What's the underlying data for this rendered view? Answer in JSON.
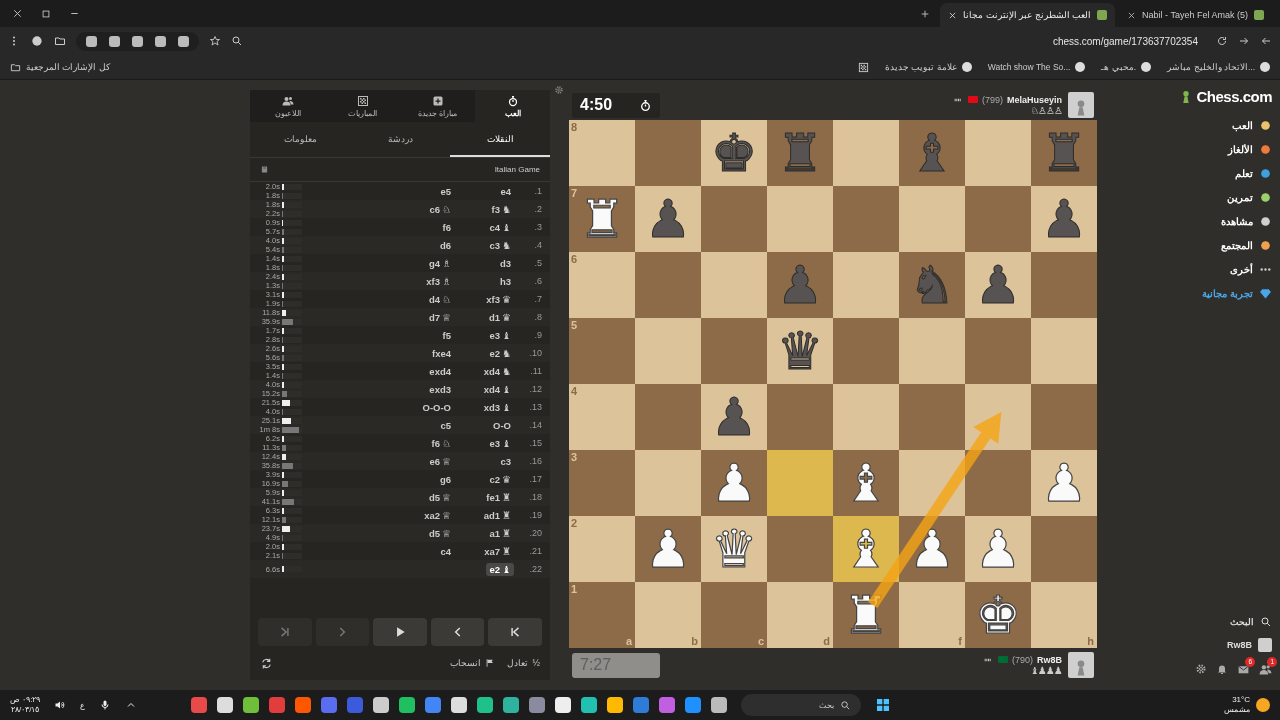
{
  "browser": {
    "tabs": [
      {
        "title": "العب الشطرنج عبر الإنترنت مجانا",
        "selected": true
      },
      {
        "title": "(5) Nabil - Tayeh Fel Amak",
        "selected": false
      }
    ],
    "address": "chess.com/game/173637702354",
    "bookmarks": [
      {
        "label": "الاتحاد والخليج مباشر..."
      },
      {
        "label": "محبي هـ."
      },
      {
        "label": "Watch show The So..."
      },
      {
        "label": "علامة تبويب جديدة"
      }
    ],
    "all_bookmarks": "كل الإشارات المرجعية"
  },
  "panel": {
    "top_tabs": [
      {
        "label": "العب",
        "selected": true
      },
      {
        "label": "مباراة جديدة",
        "selected": false
      },
      {
        "label": "المباريات",
        "selected": false
      },
      {
        "label": "اللاعبون",
        "selected": false
      }
    ],
    "sub_tabs": [
      {
        "label": "النقلات",
        "selected": true
      },
      {
        "label": "دردشة",
        "selected": false
      },
      {
        "label": "معلومات",
        "selected": false
      }
    ],
    "opening": "Italian Game",
    "moves": [
      {
        "number": "1.",
        "white": {
          "san": "e4",
          "selected": false
        },
        "black": {
          "san": "e5",
          "selected": false
        },
        "times": [
          {
            "text": "2.0s",
            "level": 0.08
          },
          {
            "text": "1.8s",
            "level": 0.06
          }
        ]
      },
      {
        "number": "2.",
        "white": {
          "san": "f3",
          "figure": "♞",
          "selected": false
        },
        "black": {
          "san": "c6",
          "figure": "♘",
          "selected": false
        },
        "times": [
          {
            "text": "1.8s",
            "level": 0.08
          },
          {
            "text": "2.2s",
            "level": 0.06
          }
        ]
      },
      {
        "number": "3.",
        "white": {
          "san": "c4",
          "figure": "♝",
          "selected": false
        },
        "black": {
          "san": "f6",
          "selected": false
        },
        "times": [
          {
            "text": "0.9s",
            "level": 0.06
          },
          {
            "text": "5.7s",
            "level": 0.08
          }
        ]
      },
      {
        "number": "4.",
        "white": {
          "san": "c3",
          "figure": "♞",
          "selected": false
        },
        "black": {
          "san": "d6",
          "selected": false
        },
        "times": [
          {
            "text": "4.0s",
            "level": 0.1
          },
          {
            "text": "5.4s",
            "level": 0.08
          }
        ]
      },
      {
        "number": "5.",
        "white": {
          "san": "d3",
          "selected": false
        },
        "black": {
          "san": "g4",
          "figure": "♗",
          "selected": false
        },
        "times": [
          {
            "text": "1.4s",
            "level": 0.08
          },
          {
            "text": "1.8s",
            "level": 0.06
          }
        ]
      },
      {
        "number": "6.",
        "white": {
          "san": "h3",
          "selected": false
        },
        "black": {
          "san": "xf3",
          "figure": "♗",
          "selected": false
        },
        "times": [
          {
            "text": "2.4s",
            "level": 0.08
          },
          {
            "text": "1.3s",
            "level": 0.06
          }
        ]
      },
      {
        "number": "7.",
        "white": {
          "san": "xf3",
          "figure": "♛",
          "selected": false
        },
        "black": {
          "san": "d4",
          "figure": "♘",
          "selected": false
        },
        "times": [
          {
            "text": "3.1s",
            "level": 0.08
          },
          {
            "text": "1.9s",
            "level": 0.06
          }
        ]
      },
      {
        "number": "8.",
        "white": {
          "san": "d1",
          "figure": "♛",
          "selected": false
        },
        "black": {
          "san": "d7",
          "figure": "♕",
          "selected": false
        },
        "times": [
          {
            "text": "11.8s",
            "level": 0.2
          },
          {
            "text": "35.9s",
            "level": 0.55
          }
        ]
      },
      {
        "number": "9.",
        "white": {
          "san": "e3",
          "figure": "♝",
          "selected": false
        },
        "black": {
          "san": "f5",
          "selected": false
        },
        "times": [
          {
            "text": "1.7s",
            "level": 0.08
          },
          {
            "text": "2.8s",
            "level": 0.06
          }
        ]
      },
      {
        "number": "10.",
        "white": {
          "san": "e2",
          "figure": "♞",
          "selected": false
        },
        "black": {
          "san": "fxe4",
          "selected": false
        },
        "times": [
          {
            "text": "2.6s",
            "level": 0.08
          },
          {
            "text": "5.6s",
            "level": 0.08
          }
        ]
      },
      {
        "number": "11.",
        "white": {
          "san": "xd4",
          "figure": "♞",
          "selected": false
        },
        "black": {
          "san": "exd4",
          "selected": false
        },
        "times": [
          {
            "text": "3.5s",
            "level": 0.1
          },
          {
            "text": "1.4s",
            "level": 0.06
          }
        ]
      },
      {
        "number": "12.",
        "white": {
          "san": "xd4",
          "figure": "♝",
          "selected": false
        },
        "black": {
          "san": "exd3",
          "selected": false
        },
        "times": [
          {
            "text": "4.0s",
            "level": 0.1
          },
          {
            "text": "15.2s",
            "level": 0.25
          }
        ]
      },
      {
        "number": "13.",
        "white": {
          "san": "xd3",
          "figure": "♝",
          "selected": false
        },
        "black": {
          "san": "O-O-O",
          "selected": false
        },
        "times": [
          {
            "text": "21.5s",
            "level": 0.4
          },
          {
            "text": "4.0s",
            "level": 0.06
          }
        ]
      },
      {
        "number": "14.",
        "white": {
          "san": "O-O",
          "selected": false
        },
        "black": {
          "san": "c5",
          "selected": false
        },
        "times": [
          {
            "text": "25.1s",
            "level": 0.45
          },
          {
            "text": "1m 8s",
            "level": 0.85
          }
        ]
      },
      {
        "number": "15.",
        "white": {
          "san": "e3",
          "figure": "♝",
          "selected": false
        },
        "black": {
          "san": "f6",
          "figure": "♘",
          "selected": false
        },
        "times": [
          {
            "text": "6.2s",
            "level": 0.1
          },
          {
            "text": "11.3s",
            "level": 0.2
          }
        ]
      },
      {
        "number": "16.",
        "white": {
          "san": "c3",
          "selected": false
        },
        "black": {
          "san": "e6",
          "figure": "♕",
          "selected": false
        },
        "times": [
          {
            "text": "12.4s",
            "level": 0.22
          },
          {
            "text": "35.8s",
            "level": 0.55
          }
        ]
      },
      {
        "number": "17.",
        "white": {
          "san": "c2",
          "figure": "♛",
          "selected": false
        },
        "black": {
          "san": "g6",
          "selected": false
        },
        "times": [
          {
            "text": "3.9s",
            "level": 0.1
          },
          {
            "text": "16.9s",
            "level": 0.3
          }
        ]
      },
      {
        "number": "18.",
        "white": {
          "san": "fe1",
          "figure": "♜",
          "selected": false
        },
        "black": {
          "san": "d5",
          "figure": "♕",
          "selected": false
        },
        "times": [
          {
            "text": "5.9s",
            "level": 0.1
          },
          {
            "text": "41.1s",
            "level": 0.6
          }
        ]
      },
      {
        "number": "19.",
        "white": {
          "san": "ad1",
          "figure": "♜",
          "selected": false
        },
        "black": {
          "san": "xa2",
          "figure": "♕",
          "selected": false
        },
        "times": [
          {
            "text": "6.3s",
            "level": 0.1
          },
          {
            "text": "12.1s",
            "level": 0.22
          }
        ]
      },
      {
        "number": "20.",
        "white": {
          "san": "a1",
          "figure": "♜",
          "selected": false
        },
        "black": {
          "san": "d5",
          "figure": "♕",
          "selected": false
        },
        "times": [
          {
            "text": "23.7s",
            "level": 0.42
          },
          {
            "text": "4.9s",
            "level": 0.06
          }
        ]
      },
      {
        "number": "21.",
        "white": {
          "san": "xa7",
          "figure": "♜",
          "selected": false
        },
        "black": {
          "san": "c4",
          "selected": false
        },
        "times": [
          {
            "text": "2.0s",
            "level": 0.08
          },
          {
            "text": "2.1s",
            "level": 0.06
          }
        ]
      },
      {
        "number": "22.",
        "white": {
          "san": "e2",
          "figure": "♝",
          "selected": true
        },
        "times": [
          {
            "text": "6.6s",
            "level": 0.1
          }
        ]
      }
    ],
    "controls": [
      {
        "kind": "first",
        "disabled": false
      },
      {
        "kind": "prev",
        "disabled": false
      },
      {
        "kind": "play",
        "disabled": false
      },
      {
        "kind": "next",
        "disabled": true
      },
      {
        "kind": "last",
        "disabled": true
      }
    ],
    "actions": [
      {
        "kind": "draw",
        "symbol": "½",
        "label": "تعادل"
      },
      {
        "kind": "resign",
        "label": "انسحاب"
      }
    ]
  },
  "players": [
    {
      "name": "MelaHuseyin",
      "rating": "(799)",
      "clock": "4:50",
      "active": true,
      "captured": "♘♙♙♙",
      "color": "#e30a17"
    },
    {
      "name": "Rw8B",
      "rating": "(790)",
      "clock": "7:27",
      "active": false,
      "captured": "♝♟♟♟",
      "color": "#006c35"
    }
  ],
  "board": {
    "rows": [
      [
        {
          "highlighted": false,
          "rank": "8"
        },
        {
          "highlighted": false
        },
        {
          "highlighted": false,
          "piece": "♚",
          "kind": "black"
        },
        {
          "highlighted": false,
          "piece": "♜",
          "kind": "black"
        },
        {
          "highlighted": false
        },
        {
          "highlighted": false,
          "piece": "♝",
          "kind": "black"
        },
        {
          "highlighted": false
        },
        {
          "highlighted": false,
          "piece": "♜",
          "kind": "black"
        }
      ],
      [
        {
          "highlighted": false,
          "rank": "7",
          "piece": "♜",
          "kind": "white"
        },
        {
          "highlighted": false,
          "piece": "♟",
          "kind": "black"
        },
        {
          "highlighted": false
        },
        {
          "highlighted": false
        },
        {
          "highlighted": false
        },
        {
          "highlighted": false
        },
        {
          "highlighted": false
        },
        {
          "highlighted": false,
          "piece": "♟",
          "kind": "black"
        }
      ],
      [
        {
          "highlighted": false,
          "rank": "6"
        },
        {
          "highlighted": false
        },
        {
          "highlighted": false
        },
        {
          "highlighted": false,
          "piece": "♟",
          "kind": "black"
        },
        {
          "highlighted": false
        },
        {
          "highlighted": false,
          "piece": "♞",
          "kind": "black"
        },
        {
          "highlighted": false,
          "piece": "♟",
          "kind": "black"
        },
        {
          "highlighted": false
        }
      ],
      [
        {
          "highlighted": false,
          "rank": "5"
        },
        {
          "highlighted": false
        },
        {
          "highlighted": false
        },
        {
          "highlighted": false,
          "piece": "♛",
          "kind": "black"
        },
        {
          "highlighted": false
        },
        {
          "highlighted": false
        },
        {
          "highlighted": false
        },
        {
          "highlighted": false
        }
      ],
      [
        {
          "highlighted": false,
          "rank": "4"
        },
        {
          "highlighted": false
        },
        {
          "highlighted": false,
          "piece": "♟",
          "kind": "black"
        },
        {
          "highlighted": false
        },
        {
          "highlighted": false
        },
        {
          "highlighted": false
        },
        {
          "highlighted": false,
          "arrow_to": true
        },
        {
          "highlighted": false
        }
      ],
      [
        {
          "highlighted": false,
          "rank": "3"
        },
        {
          "highlighted": false
        },
        {
          "highlighted": false,
          "piece": "♟",
          "kind": "white"
        },
        {
          "highlighted": true
        },
        {
          "highlighted": false,
          "piece": "♝",
          "kind": "white"
        },
        {
          "highlighted": false
        },
        {
          "highlighted": false
        },
        {
          "highlighted": false,
          "piece": "♟",
          "kind": "white"
        }
      ],
      [
        {
          "highlighted": false,
          "rank": "2"
        },
        {
          "highlighted": false,
          "piece": "♟",
          "kind": "white"
        },
        {
          "highlighted": false,
          "piece": "♛",
          "kind": "white"
        },
        {
          "highlighted": false
        },
        {
          "highlighted": true,
          "piece": "♝",
          "kind": "white"
        },
        {
          "highlighted": false,
          "piece": "♟",
          "kind": "white"
        },
        {
          "highlighted": false,
          "piece": "♟",
          "kind": "white"
        },
        {
          "highlighted": false
        }
      ],
      [
        {
          "highlighted": false,
          "rank": "1",
          "file": "a"
        },
        {
          "highlighted": false,
          "file": "b"
        },
        {
          "highlighted": false,
          "file": "c"
        },
        {
          "highlighted": false,
          "file": "d"
        },
        {
          "highlighted": false,
          "piece": "♜",
          "kind": "white",
          "arrow_from": true
        },
        {
          "highlighted": false,
          "file": "f"
        },
        {
          "highlighted": false,
          "piece": "♚",
          "kind": "white"
        },
        {
          "highlighted": false,
          "file": "h"
        }
      ]
    ]
  },
  "sidebar": {
    "logo": "Chess.com",
    "items": [
      {
        "label": "العب",
        "kind": "link"
      },
      {
        "label": "الألغاز",
        "kind": "link"
      },
      {
        "label": "تعلم",
        "kind": "link"
      },
      {
        "label": "تمرين",
        "kind": "link"
      },
      {
        "label": "مشاهدة",
        "kind": "link"
      },
      {
        "label": "المجتمع",
        "kind": "link"
      },
      {
        "label": "أخرى",
        "kind": "link"
      },
      {
        "label": "تجربة مجانية",
        "kind": "promo"
      }
    ],
    "search": "البحث",
    "user": "Rw8B",
    "badges": [
      {
        "kind": "mail",
        "count": "6"
      },
      {
        "kind": "friends",
        "count": "1"
      }
    ]
  },
  "taskbar": {
    "weather_temp": "31°C",
    "weather_text": "مشمس",
    "search": "بحث",
    "language": "ع",
    "time": "٠٩:٢٩ ص",
    "date": "٢٨/٠٣/١٥"
  }
}
